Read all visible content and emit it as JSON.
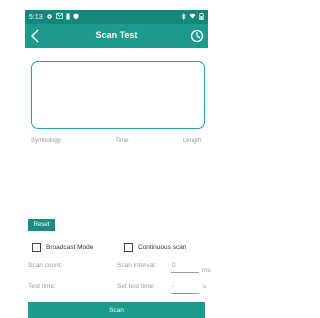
{
  "status_bar": {
    "time": "5:13",
    "left_icons": [
      "gear-icon",
      "mail-icon",
      "sim-icon",
      "shield-icon"
    ],
    "right_icons": [
      "bluetooth-icon",
      "wifi-icon",
      "battery-icon"
    ]
  },
  "app_bar": {
    "title": "Scan Test",
    "back_icon": "back-arrow-icon",
    "action_icon": "timer-icon"
  },
  "info": {
    "symbology": "Symbology:",
    "time": "Time:",
    "length": "Length:"
  },
  "buttons": {
    "reset": "Reset",
    "scan": "Scan"
  },
  "options": {
    "broadcast_mode": "Broadcast Mode",
    "continuous_scan": "Continuous scan"
  },
  "fields": {
    "scan_count_label": "Scan count:",
    "scan_interval_label": "Scan interval:",
    "scan_interval_value": "0",
    "scan_interval_unit": "ms",
    "test_time_label": "Test time:",
    "set_test_time_label": "Set test time:",
    "set_test_time_value": "-",
    "set_test_time_unit": "s"
  },
  "colors": {
    "primary": "#1c9a8b",
    "status_bar": "#16877b",
    "outline": "#2aa397"
  }
}
